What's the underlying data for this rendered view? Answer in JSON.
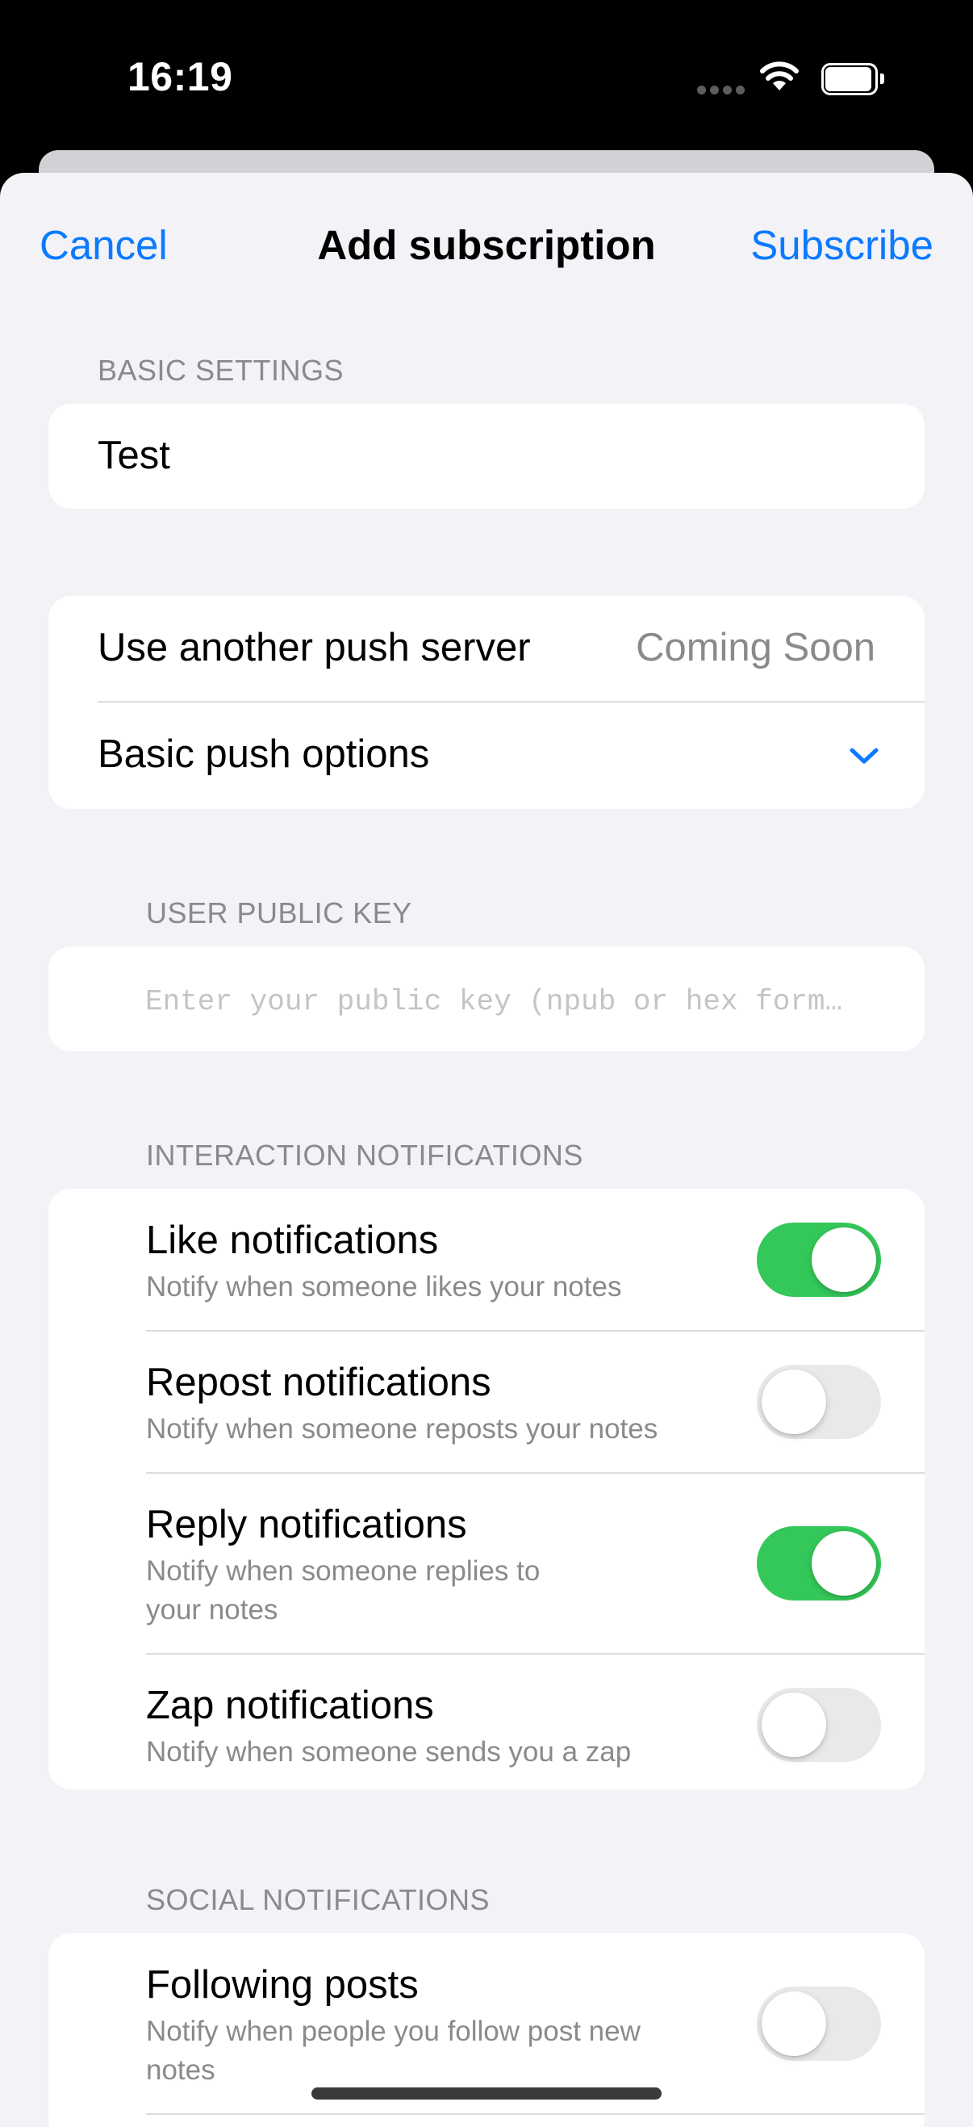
{
  "status_bar": {
    "time": "16:19"
  },
  "nav": {
    "cancel_label": "Cancel",
    "title": "Add subscription",
    "subscribe_label": "Subscribe"
  },
  "basic_settings": {
    "header": "BASIC SETTINGS",
    "name_value": "Test"
  },
  "server": {
    "use_another_label": "Use another push server",
    "use_another_detail": "Coming Soon",
    "basic_options_label": "Basic push options"
  },
  "public_key": {
    "header": "USER PUBLIC KEY",
    "placeholder": "Enter your public key (npub or hex form…"
  },
  "interaction": {
    "header": "INTERACTION NOTIFICATIONS",
    "items": [
      {
        "title": "Like notifications",
        "desc": "Notify when someone likes your notes",
        "enabled": true
      },
      {
        "title": "Repost notifications",
        "desc": "Notify when someone reposts your notes",
        "enabled": false
      },
      {
        "title": "Reply notifications",
        "desc": "Notify when someone replies to your notes",
        "enabled": true
      },
      {
        "title": "Zap notifications",
        "desc": "Notify when someone sends you a zap",
        "enabled": false
      }
    ]
  },
  "social": {
    "header": "SOCIAL NOTIFICATIONS",
    "items": [
      {
        "title": "Following posts",
        "desc": "Notify when people you follow post new notes",
        "enabled": false
      }
    ]
  },
  "colors": {
    "accent": "#0a7aff",
    "toggle_on": "#34c759",
    "background": "#f2f2f7"
  }
}
